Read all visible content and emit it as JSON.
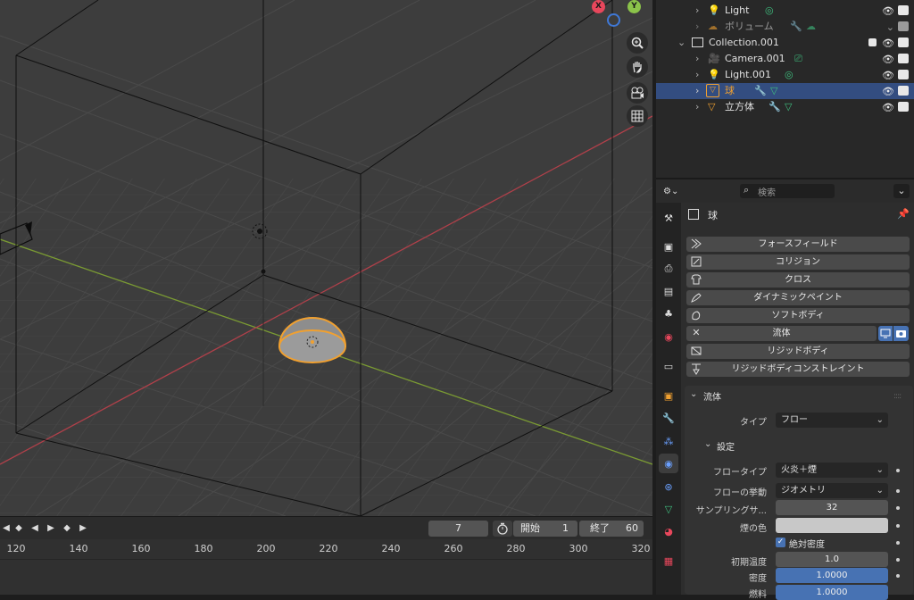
{
  "viewport": {
    "gizmo": {
      "x_label": "X",
      "y_label": "Y",
      "x_color": "#e8475c",
      "y_color": "#8bc34a",
      "z_color": "#3f78d6"
    },
    "nav_icons": [
      "zoom-icon",
      "hand-pan-icon",
      "camera-view-icon",
      "grid-ortho-icon"
    ]
  },
  "timeline": {
    "current_frame": "7",
    "start_label": "開始",
    "start_value": "1",
    "end_label": "終了",
    "end_value": "60",
    "ticks": [
      "120",
      "140",
      "160",
      "180",
      "200",
      "220",
      "240",
      "260",
      "280",
      "300",
      "320"
    ]
  },
  "outliner": {
    "rows": [
      {
        "label": "Light",
        "indent": 2
      },
      {
        "label": "ボリューム",
        "indent": 2
      },
      {
        "label": "Collection.001",
        "indent": 1
      },
      {
        "label": "Camera.001",
        "indent": 2
      },
      {
        "label": "Light.001",
        "indent": 2
      },
      {
        "label": "球",
        "indent": 2,
        "selected": true
      },
      {
        "label": "立方体",
        "indent": 2
      }
    ]
  },
  "properties": {
    "search_placeholder": "検索",
    "object_name": "球",
    "physics_buttons": [
      "フォースフィールド",
      "コリジョン",
      "クロス",
      "ダイナミックペイント",
      "ソフトボディ",
      "流体",
      "リジッドボディ",
      "リジッドボディコンストレイント"
    ],
    "fluid_panel_title": "流体",
    "type_label": "タイプ",
    "type_value": "フロー",
    "settings_title": "設定",
    "flow_type_label": "フロータイプ",
    "flow_type_value": "火炎＋煙",
    "flow_behavior_label": "フローの挙動",
    "flow_behavior_value": "ジオメトリ",
    "sampling_label": "サンプリングサ...",
    "sampling_value": "32",
    "smoke_color_label": "煙の色",
    "smoke_color": "#c8c8c8",
    "absolute_density_label": "絶対密度",
    "initial_temp_label": "初期温度",
    "initial_temp_value": "1.0",
    "density_label": "密度",
    "density_value": "1.0000",
    "fuel_label": "燃料",
    "fuel_value": "1.0000"
  },
  "colors": {
    "accent_blue": "#4772b3",
    "selection_orange": "#f0a030",
    "selected_row": "#334d80"
  }
}
